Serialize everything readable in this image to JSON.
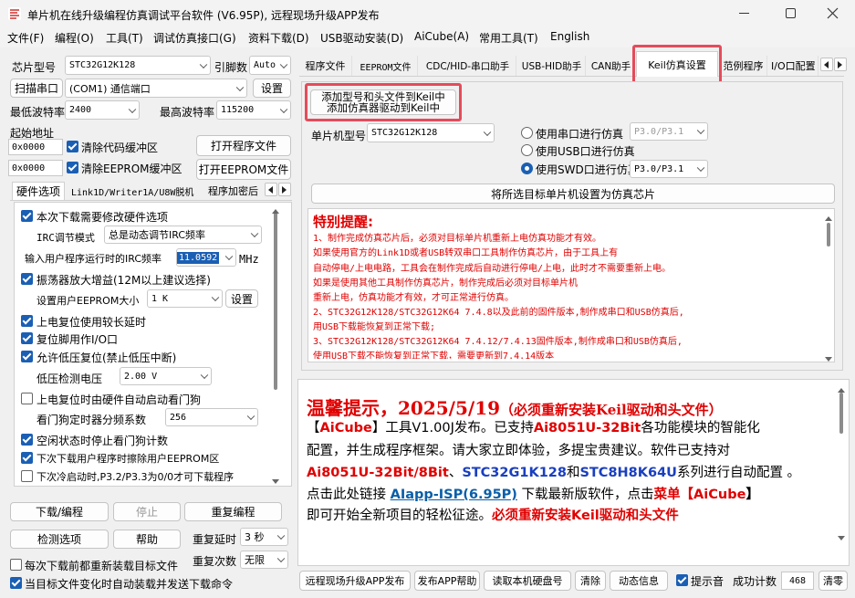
{
  "window": {
    "title": "单片机在线升级编程仿真调试平台软件 (V6.95P), 远程现场升级APP发布",
    "minimize_icon": "minimize-icon",
    "maximize_icon": "maximize-icon",
    "close_icon": "close-icon"
  },
  "menu": [
    "文件(F)",
    "编程(O)",
    "工具(T)",
    "调试仿真接口(G)",
    "资料下载(D)",
    "USB驱动安装(D)",
    "AiCube(A)",
    "常用工具(T)",
    "English"
  ],
  "left": {
    "chip_label": "芯片型号",
    "chip_value": "STC32G12K128",
    "pins_label": "引脚数",
    "pins_value": "Auto",
    "scan_button": "扫描串口",
    "port_value": "(COM1) 通信端口",
    "port_settings_button": "设置",
    "min_baud_label": "最低波特率",
    "min_baud_value": "2400",
    "max_baud_label": "最高波特率",
    "max_baud_value": "115200",
    "start_addr_label": "起始地址",
    "code_addr": "0x0000",
    "clear_code_label": "清除代码缓冲区",
    "open_program_button": "打开程序文件",
    "eeprom_addr": "0x0000",
    "clear_eeprom_label": "清除EEPROM缓冲区",
    "open_eeprom_button": "打开EEPROM文件",
    "tabs": [
      "硬件选项",
      "Link1D/Writer1A/U8W脱机",
      "程序加密后"
    ],
    "hw": {
      "modify_label": "本次下载需要修改硬件选项",
      "irc_mode_label": "IRC调节模式",
      "irc_mode_value": "总是动态调节IRC频率",
      "irc_freq_label": "输入用户程序运行时的IRC频率",
      "irc_freq_value": "11.0592",
      "irc_unit": "MHz",
      "osc_label": "振荡器放大增益(12M以上建议选择)",
      "eeprom_size_label": "设置用户EEPROM大小",
      "eeprom_size_value": "1   K",
      "eeprom_settings_button": "设置",
      "por_delay_label": "上电复位使用较长延时",
      "reset_io_label": "复位脚用作I/O口",
      "lvr_label": "允许低压复位(禁止低压中断)",
      "lvd_label": "低压检测电压",
      "lvd_value": "2.00 V",
      "wdt_label": "上电复位时由硬件自动启动看门狗",
      "wdt_div_label": "看门狗定时器分频系数",
      "wdt_div_value": "256",
      "idle_wdt_label": "空闲状态时停止看门狗计数",
      "erase_eeprom_label": "下次下载用户程序时擦除用户EEPROM区",
      "cold_label": "下次冷启动时,P3.2/P3.3为0/0才可下载程序"
    },
    "download_button": "下载/编程",
    "stop_button": "停止",
    "reprogram_button": "重复编程",
    "detect_button": "检测选项",
    "help_button": "帮助",
    "repeat_delay_label": "重复延时",
    "repeat_delay_value": "3 秒",
    "repeat_count_label": "重复次数",
    "repeat_count_value": "无限",
    "reload_label": "每次下载前都重新装载目标文件",
    "auto_send_label": "当目标文件变化时自动装载并发送下载命令"
  },
  "right": {
    "tabs": [
      "程序文件",
      "EEPROM文件",
      "CDC/HID-串口助手",
      "USB-HID助手",
      "CAN助手",
      "Keil仿真设置",
      "范例程序",
      "I/O口配置"
    ],
    "keil": {
      "add_model_button_line1": "添加型号和头文件到Keil中",
      "add_model_button_line2": "添加仿真器驱动到Keil中",
      "mcu_label": "单片机型号",
      "mcu_value": "STC32G12K128",
      "radio_serial": "使用串口进行仿真",
      "serial_pins": "P3.0/P3.1",
      "radio_usb": "使用USB口进行仿真",
      "radio_swd": "使用SWD口进行仿真",
      "swd_pins": "P3.0/P3.1",
      "set_chip_button": "将所选目标单片机设置为仿真芯片",
      "notice_title": "特别提醒:",
      "notice_lines": [
        "1、制作完成仿真芯片后，必须对目标单片机重新上电仿真功能才有效。",
        "   如果使用官方的Link1D或者USB转双串口工具制作仿真芯片，由于工具上有",
        "   自动停电/上电电路，工具会在制作完成后自动进行停电/上电，此时才不需要重新上电。",
        "   如果是使用其他工具制作仿真芯片，制作完成后必须对目标单片机",
        "   重新上电，仿真功能才有效，才可正常进行仿真。",
        "2、STC32G12K128/STC32G12K64  7.4.8以及此前的固件版本,制作成串口和USB仿真后,",
        "   用USB下载能恢复到正常下载;",
        "3、STC32G12K128/STC32G12K64  7.4.12/7.4.13固件版本,制作成串口和USB仿真后,",
        "   使用USB下载不能恢复到正常下载，需要更新到7.4.14版本"
      ]
    },
    "announce": {
      "heading_main": "温馨提示，2025/5/19",
      "heading_paren": "（必须重新安装Keil驱动和头文件）",
      "line2_a": "【",
      "line2_b": "AiCube",
      "line2_c": "】工具V1.00J发布。已支持",
      "line2_d": "Ai8051U-32Bit",
      "line2_e": "各功能模块的智能化",
      "line3": "配置，并生成程序框架。请大家立即体验，多提宝贵建议。软件已支持对",
      "line4_a": "Ai8051U-32Bit/8Bit",
      "line4_b": "、",
      "line4_c": "STC32G1K128",
      "line4_d": "和",
      "line4_e": "STC8H8K64U",
      "line4_f": "系列进行自动配置 。",
      "line5_a": "点击此处链接 ",
      "line5_link": "AIapp-ISP(6.95P)",
      "line5_b": " 下载最新版软件，点击",
      "line5_c": "菜单【",
      "line5_d": "AiCube",
      "line5_e": "】",
      "line6_a": "即可开始全新项目的轻松征途。",
      "line6_b": "必须重新安装Keil驱动和头文件"
    },
    "bottom": {
      "remote_button": "远程现场升级APP发布",
      "publish_help_button": "发布APP帮助",
      "read_disk_button": "读取本机硬盘号",
      "clear_button": "清除",
      "dynamic_button": "动态信息",
      "beep_label": "提示音",
      "success_label": "成功计数",
      "success_value": "468",
      "reset_count_button": "清零"
    }
  },
  "colors": {
    "accent": "#1a5fb4",
    "highlight": "#e54b5b",
    "notice_red": "#e00000",
    "link_blue": "#0b5ea8"
  }
}
